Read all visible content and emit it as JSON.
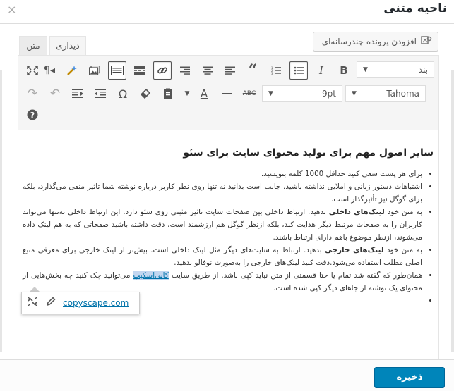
{
  "dialog": {
    "title": "ناحیه متنی",
    "close_symbol": "×"
  },
  "media": {
    "add_media_label": "افزودن پرونده چندرسانه‌ای"
  },
  "tabs": [
    {
      "label": "دیداری"
    },
    {
      "label": "متن"
    }
  ],
  "toolbar": {
    "format_select": "بند",
    "font_select": "Tahoma",
    "size_select": "9pt"
  },
  "content": {
    "heading": "سایر اصول مهم برای تولید محتوای سایت برای سئو",
    "items": [
      {
        "text": "برای هر پست سعی کنید حداقل 1000 کلمه بنویسید."
      },
      {
        "text": "اشتباهات دستور زبانی و املایی نداشته باشید. جالب است بدانید نه تنها روی نظر کاربر درباره نوشته شما تاثیر منفی می‌گذارد، بلکه برای گوگل نیز تأثیرگذار است."
      },
      {
        "before": "به متن خود ",
        "bold": "لینک‌های داخلی",
        "after": " بدهید. ارتباط داخلی بین صفحات سایت تاثیر مثبتی روی سئو دارد. این ارتباط داخلی نه‌تنها می‌تواند کاربران را به صفحات مرتبط دیگر هدایت کند، بلکه ازنظر گوگل هم ارزشمند است، دقت داشته باشید صفحاتی که به هم لینک داده می‌شوند، ازنظر موضوع باهم دارای ارتباط باشند."
      },
      {
        "before": "به متن خود ",
        "bold": "لینک‌های خارجی",
        "after": " بدهید. ارتباط به سایت‌های دیگر مثل لینک داخلی است. بیش‌تر از لینک خارجی برای معرفی منبع اصلی مطلب استفاده می‌شود.دقت کنید لینک‌های خارجی را به‌صورت نوفالو بدهید."
      },
      {
        "before": "همان‌طور که گفته شد تمام یا حتا قسمتی از متن نباید کپی باشد. از طریق سایت ",
        "link": "کاپی‌اسکیپ",
        "after": " می‌توانید چک کنید چه بخش‌هایی از محتوای یک نوشته از جاهای دیگر کپی شده است."
      },
      {
        "text": ""
      }
    ]
  },
  "link_popup": {
    "url": "copyscape.com"
  },
  "footer": {
    "save_label": "ذخیره"
  },
  "colors": {
    "primary": "#0085ba",
    "link": "#0073aa"
  }
}
